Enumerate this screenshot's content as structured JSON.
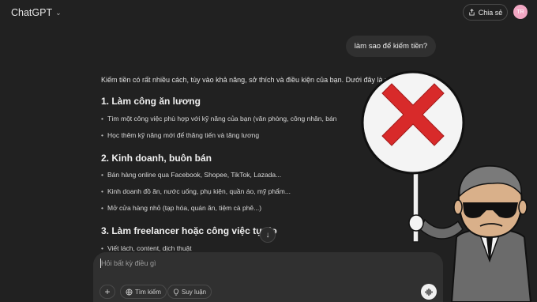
{
  "topbar": {
    "brand": "ChatGPT",
    "share_label": "Chia sẻ",
    "avatar_initials": "TR"
  },
  "user_message": "làm sao để kiếm tiền?",
  "answer": {
    "intro": "Kiếm tiền có rất nhiều cách, tùy vào khả năng, sở thích và điều kiện của bạn. Dưới đây là một số gợi ý:",
    "sections": [
      {
        "heading": "1. Làm công ăn lương",
        "bullets": [
          "Tìm một công việc phù hợp với kỹ năng của bạn (văn phòng, công nhân, bán",
          "Học thêm kỹ năng mới để thăng tiến và tăng lương"
        ]
      },
      {
        "heading": "2. Kinh doanh, buôn bán",
        "bullets": [
          "Bán hàng online qua Facebook, Shopee, TikTok, Lazada...",
          "Kinh doanh đồ ăn, nước uống, phụ kiện, quần áo, mỹ phẩm...",
          "Mở cửa hàng nhỏ (tạp hóa, quán ăn, tiệm cà phê...)"
        ]
      },
      {
        "heading": "3. Làm freelancer hoặc công việc tự do",
        "bullets": [
          "Viết lách, content, dịch thuật"
        ]
      }
    ]
  },
  "composer": {
    "placeholder": "Hỏi bất kỳ điều gì",
    "search_label": "Tìm kiếm",
    "reason_label": "Suy luận"
  },
  "colors": {
    "background": "#212121",
    "sign_red": "#d82a2a",
    "avatar": "#f2a7c3"
  },
  "icons": [
    "chevron-down-icon",
    "share-icon",
    "scroll-down-icon",
    "plus-icon",
    "globe-icon",
    "lightbulb-icon",
    "voice-icon",
    "x-mark-icon"
  ]
}
